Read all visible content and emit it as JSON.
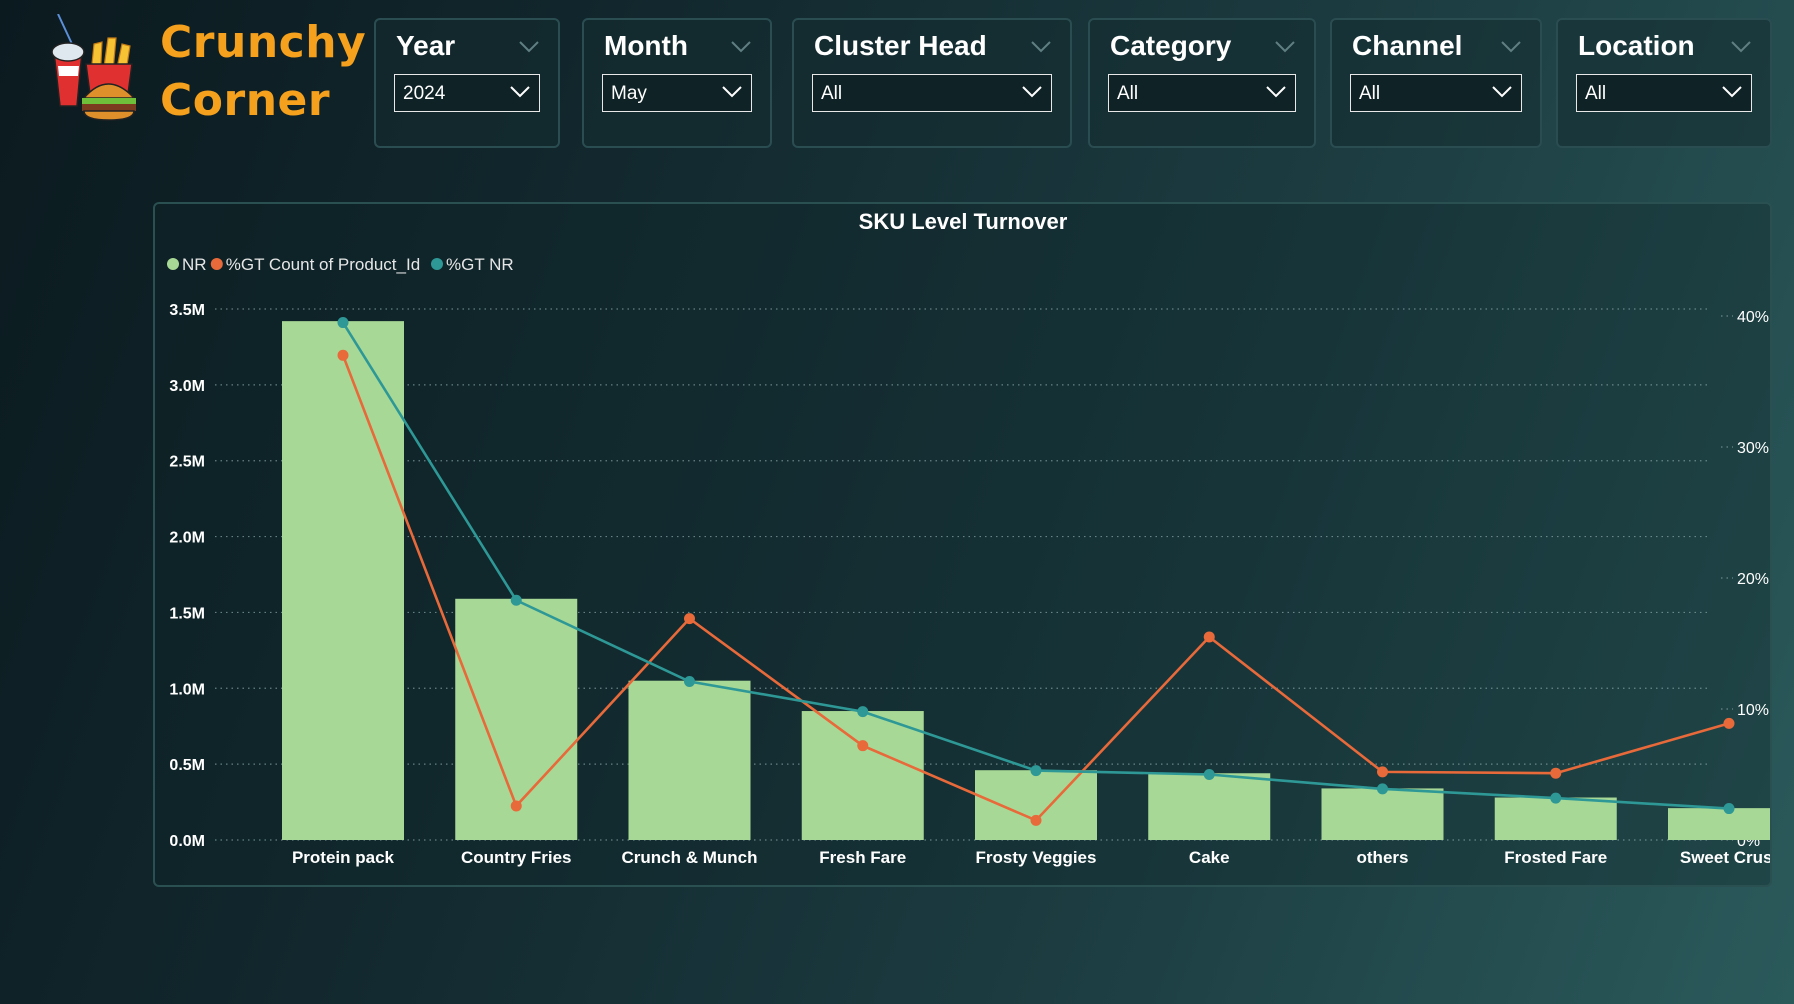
{
  "brand": {
    "line1": "Crunchy",
    "line2": "Corner",
    "logo_icon": "snacks-logo-icon"
  },
  "filters": [
    {
      "title": "Year",
      "value": "2024"
    },
    {
      "title": "Month",
      "value": "May"
    },
    {
      "title": "Cluster Head",
      "value": "All"
    },
    {
      "title": "Category",
      "value": "All"
    },
    {
      "title": "Channel",
      "value": "All"
    },
    {
      "title": "Location",
      "value": "All"
    }
  ],
  "colors": {
    "bar": "#a8d895",
    "count_line": "#e8693a",
    "nr_line": "#2e9896",
    "accent": "#f5a11d"
  },
  "chart_data": {
    "type": "bar",
    "title": "SKU Level Turnover",
    "categories": [
      "Protein pack",
      "Country Fries",
      "Crunch & Munch",
      "Fresh Fare",
      "Frosty Veggies",
      "Cake",
      "others",
      "Frosted Fare",
      "Sweet Crust"
    ],
    "series": [
      {
        "name": "NR",
        "type": "bar",
        "axis": "left",
        "values": [
          3.42,
          1.59,
          1.05,
          0.85,
          0.46,
          0.44,
          0.34,
          0.28,
          0.21
        ]
      },
      {
        "name": "%GT Count of Product_Id",
        "type": "line",
        "axis": "right",
        "values": [
          37.0,
          2.6,
          16.9,
          7.2,
          1.5,
          15.5,
          5.2,
          5.1,
          8.9
        ]
      },
      {
        "name": "%GT NR",
        "type": "line",
        "axis": "right",
        "values": [
          39.5,
          18.3,
          12.1,
          9.8,
          5.3,
          5.0,
          3.9,
          3.2,
          2.4
        ]
      }
    ],
    "left_axis": {
      "ticks": [
        "0.0M",
        "0.5M",
        "1.0M",
        "1.5M",
        "2.0M",
        "2.5M",
        "3.0M",
        "3.5M"
      ],
      "ylim": [
        0,
        3.5
      ],
      "unit": "M"
    },
    "right_axis": {
      "ticks": [
        "0%",
        "10%",
        "20%",
        "30%",
        "40%"
      ],
      "ylim": [
        0,
        40
      ],
      "unit": "%"
    },
    "legend": "top-left",
    "grid": true
  }
}
